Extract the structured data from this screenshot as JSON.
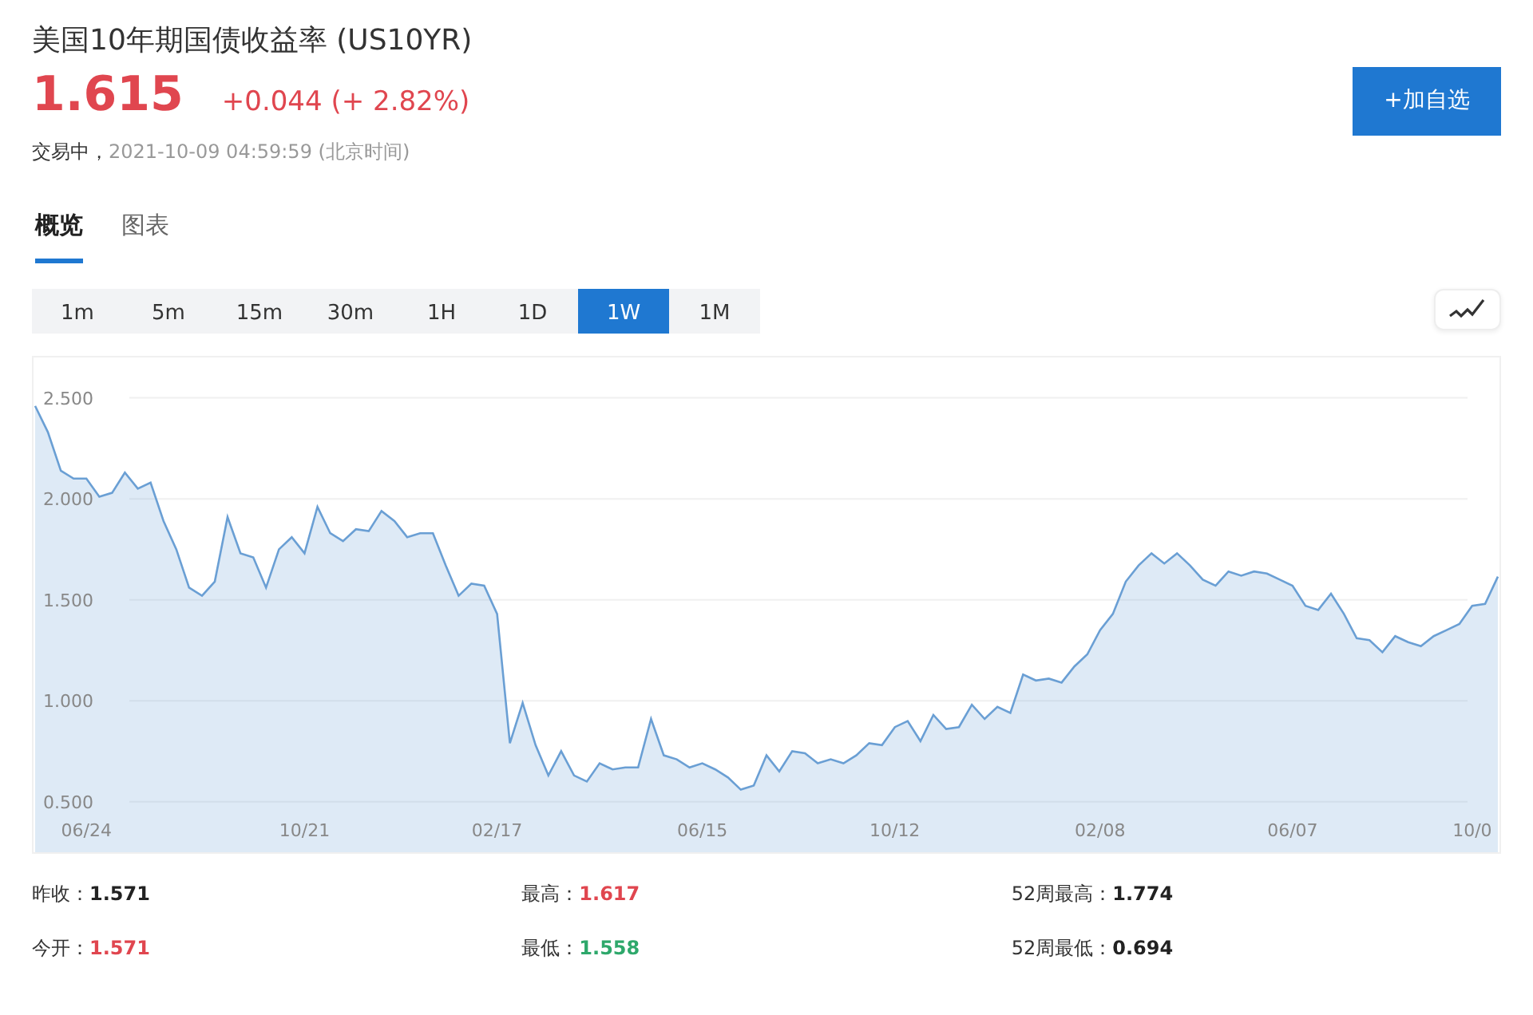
{
  "header": {
    "title": "美国10年期国债收益率",
    "symbol": "(US10YR)",
    "price": "1.615",
    "change": "+0.044 (+ 2.82%)",
    "status": "交易中，",
    "timestamp": "2021-10-09 04:59:59 (北京时间)",
    "add_button": "+加自选"
  },
  "tabs": [
    {
      "label": "概览",
      "selected": true
    },
    {
      "label": "图表",
      "selected": false
    }
  ],
  "intervals": [
    {
      "label": "1m",
      "selected": false
    },
    {
      "label": "5m",
      "selected": false
    },
    {
      "label": "15m",
      "selected": false
    },
    {
      "label": "30m",
      "selected": false
    },
    {
      "label": "1H",
      "selected": false
    },
    {
      "label": "1D",
      "selected": false
    },
    {
      "label": "1W",
      "selected": true
    },
    {
      "label": "1M",
      "selected": false
    }
  ],
  "chart": {
    "chart_data": {
      "type": "area",
      "grid": true,
      "categories": [
        null,
        null,
        null,
        null,
        "06/24",
        null,
        null,
        null,
        null,
        null,
        null,
        null,
        null,
        null,
        null,
        null,
        null,
        null,
        null,
        null,
        null,
        "10/21",
        null,
        null,
        null,
        null,
        null,
        null,
        null,
        null,
        null,
        null,
        null,
        null,
        null,
        null,
        "02/17",
        null,
        null,
        null,
        null,
        null,
        null,
        null,
        null,
        null,
        null,
        null,
        null,
        null,
        null,
        null,
        "06/15",
        null,
        null,
        null,
        null,
        null,
        null,
        null,
        null,
        null,
        null,
        null,
        null,
        null,
        null,
        "10/12",
        null,
        null,
        null,
        null,
        null,
        null,
        null,
        null,
        null,
        null,
        null,
        null,
        null,
        null,
        null,
        "02/08",
        null,
        null,
        null,
        null,
        null,
        null,
        null,
        null,
        null,
        null,
        null,
        null,
        null,
        null,
        "06/07",
        null,
        null,
        null,
        null,
        null,
        null,
        null,
        null,
        null,
        null,
        null,
        null,
        null,
        "10/0",
        null,
        null
      ],
      "ylim": [
        0.25,
        2.7
      ],
      "yticks": [
        {
          "value": 0.5,
          "label": "0.500"
        },
        {
          "value": 1,
          "label": "1.000"
        },
        {
          "value": 1.5,
          "label": "1.500"
        },
        {
          "value": 2,
          "label": "2.000"
        },
        {
          "value": 2.5,
          "label": "2.500"
        }
      ],
      "series": [
        {
          "color": "#6a9fd4",
          "values": [
            2.46,
            2.33,
            2.14,
            2.1,
            2.1,
            2.01,
            2.03,
            2.13,
            2.05,
            2.08,
            1.89,
            1.75,
            1.56,
            1.52,
            1.59,
            1.91,
            1.73,
            1.71,
            1.56,
            1.75,
            1.81,
            1.73,
            1.96,
            1.83,
            1.79,
            1.85,
            1.84,
            1.94,
            1.89,
            1.81,
            1.83,
            1.83,
            1.67,
            1.52,
            1.58,
            1.57,
            1.43,
            0.79,
            0.99,
            0.78,
            0.63,
            0.75,
            0.63,
            0.6,
            0.69,
            0.66,
            0.67,
            0.67,
            0.91,
            0.73,
            0.71,
            0.67,
            0.69,
            0.66,
            0.62,
            0.56,
            0.58,
            0.73,
            0.65,
            0.75,
            0.74,
            0.69,
            0.71,
            0.69,
            0.73,
            0.79,
            0.78,
            0.87,
            0.9,
            0.8,
            0.93,
            0.86,
            0.87,
            0.98,
            0.91,
            0.97,
            0.94,
            1.13,
            1.1,
            1.11,
            1.09,
            1.17,
            1.23,
            1.35,
            1.43,
            1.59,
            1.67,
            1.73,
            1.68,
            1.73,
            1.67,
            1.6,
            1.57,
            1.64,
            1.62,
            1.64,
            1.63,
            1.6,
            1.57,
            1.47,
            1.45,
            1.53,
            1.43,
            1.31,
            1.3,
            1.24,
            1.32,
            1.29,
            1.27,
            1.32,
            1.35,
            1.38,
            1.47,
            1.48,
            1.615
          ]
        }
      ]
    }
  },
  "stats": [
    {
      "label": "昨收：",
      "value": "1.571",
      "color": "#222222"
    },
    {
      "label": "最高：",
      "value": "1.617",
      "color": "#e0464f"
    },
    {
      "label": "52周最高：",
      "value": "1.774",
      "color": "#222222"
    },
    {
      "label": "今开：",
      "value": "1.571",
      "color": "#e0464f"
    },
    {
      "label": "最低：",
      "value": "1.558",
      "color": "#2ea86b"
    },
    {
      "label": "52周最低：",
      "value": "0.694",
      "color": "#222222"
    }
  ]
}
